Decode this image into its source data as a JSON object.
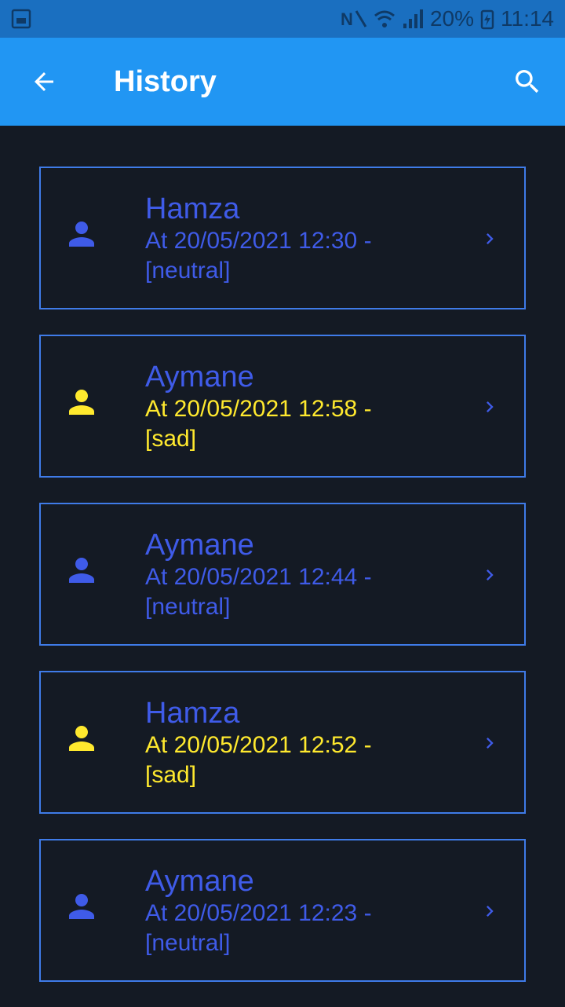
{
  "status_bar": {
    "battery": "20%",
    "time": "11:14",
    "icons": [
      "gallery-icon",
      "nfc-icon",
      "wifi-icon",
      "signal-icon",
      "battery-charging-icon"
    ]
  },
  "app_bar": {
    "title": "History",
    "back_icon": "arrow-back-icon",
    "search_icon": "search-icon",
    "background": "#2196f3"
  },
  "colors": {
    "neutral": "#3f5be8",
    "sad": "#ffe92e",
    "name": "#3f5be8",
    "card_border": "#3f7be8",
    "background": "#141a24"
  },
  "history": [
    {
      "name": "Hamza",
      "line1": "At 20/05/2021 12:30 -",
      "line2": "[neutral]",
      "mood": "neutral"
    },
    {
      "name": "Aymane",
      "line1": "At 20/05/2021 12:58 -",
      "line2": "[sad]",
      "mood": "sad"
    },
    {
      "name": "Aymane",
      "line1": "At 20/05/2021 12:44 -",
      "line2": "[neutral]",
      "mood": "neutral"
    },
    {
      "name": "Hamza",
      "line1": "At 20/05/2021 12:52 -",
      "line2": "[sad]",
      "mood": "sad"
    },
    {
      "name": "Aymane",
      "line1": "At 20/05/2021 12:23 -",
      "line2": "[neutral]",
      "mood": "neutral"
    }
  ]
}
